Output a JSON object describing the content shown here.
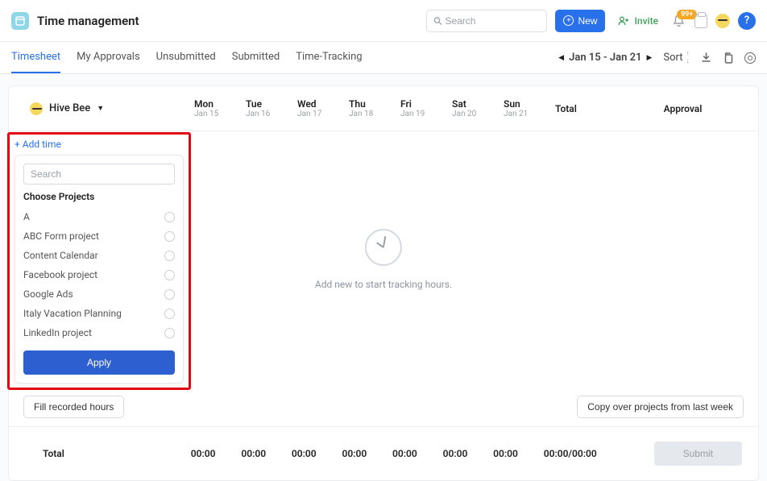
{
  "header": {
    "title": "Time management",
    "search_placeholder": "Search",
    "new_label": "New",
    "invite_label": "Invite",
    "notification_badge": "99+"
  },
  "tabs": {
    "items": [
      "Timesheet",
      "My Approvals",
      "Unsubmitted",
      "Submitted",
      "Time-Tracking"
    ],
    "active_index": 0
  },
  "toolbar": {
    "date_range": "Jan 15 - Jan 21",
    "sort_label": "Sort"
  },
  "sheet": {
    "user": "Hive Bee",
    "days": [
      {
        "label": "Mon",
        "date": "Jan 15"
      },
      {
        "label": "Tue",
        "date": "Jan 16"
      },
      {
        "label": "Wed",
        "date": "Jan 17"
      },
      {
        "label": "Thu",
        "date": "Jan 18"
      },
      {
        "label": "Fri",
        "date": "Jan 19"
      },
      {
        "label": "Sat",
        "date": "Jan 20"
      },
      {
        "label": "Sun",
        "date": "Jan 21"
      }
    ],
    "total_label": "Total",
    "approval_label": "Approval",
    "empty_text": "Add new to start tracking hours.",
    "fill_button": "Fill recorded hours",
    "copy_button": "Copy over projects from last week"
  },
  "totals": {
    "label": "Total",
    "values": [
      "00:00",
      "00:00",
      "00:00",
      "00:00",
      "00:00",
      "00:00",
      "00:00"
    ],
    "summary": "00:00/00:00",
    "submit_label": "Submit"
  },
  "picker": {
    "add_time": "+ Add time",
    "search_placeholder": "Search",
    "heading": "Choose Projects",
    "projects": [
      "A",
      "ABC Form project",
      "Content Calendar",
      "Facebook project",
      "Google Ads",
      "Italy Vacation Planning",
      "LinkedIn project"
    ],
    "apply_label": "Apply"
  }
}
